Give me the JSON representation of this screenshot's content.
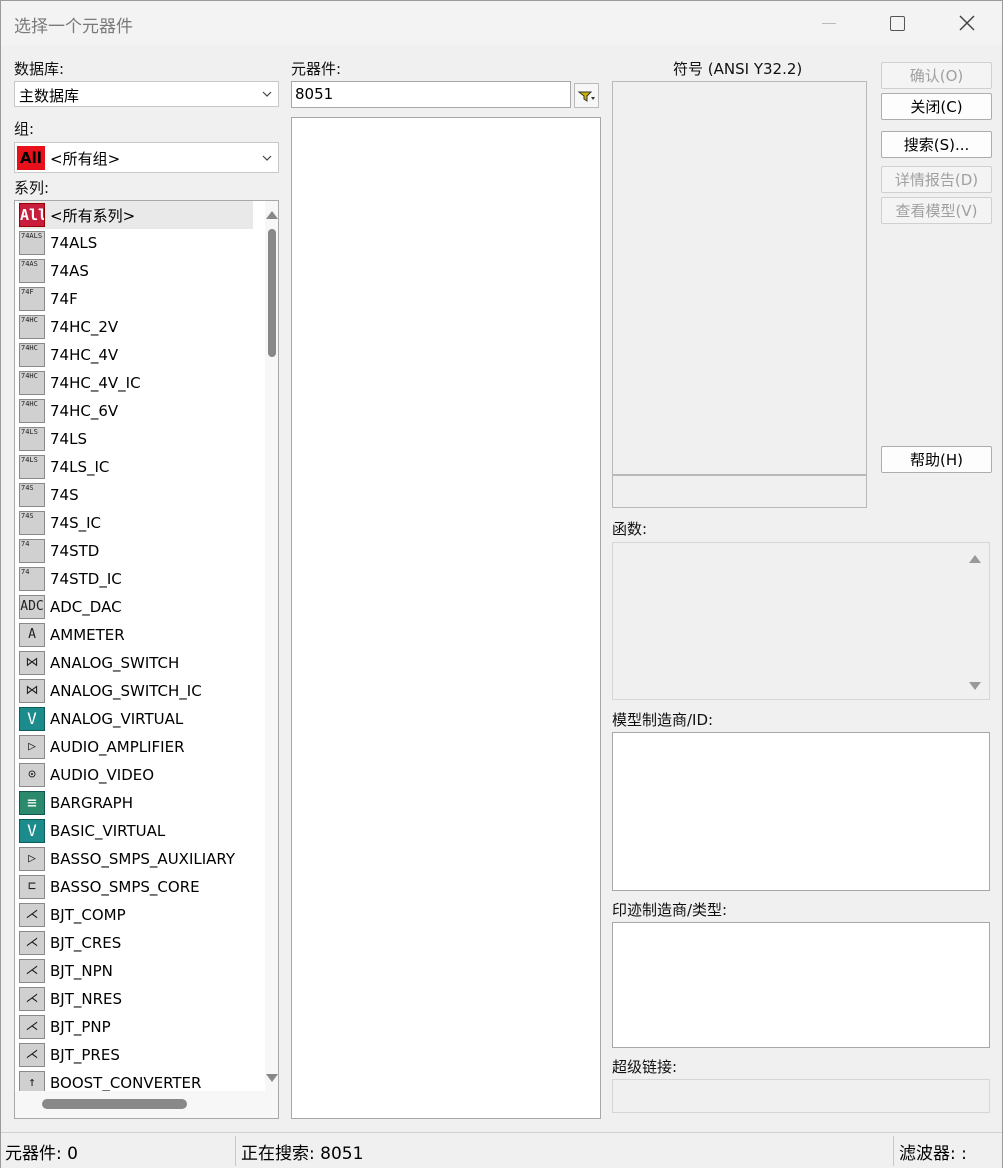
{
  "window": {
    "title": "选择一个元器件"
  },
  "database": {
    "label": "数据库:",
    "value": "主数据库"
  },
  "group": {
    "label": "组:",
    "value": "<所有组>",
    "icon_text": "All"
  },
  "series": {
    "label": "系列:",
    "items": [
      {
        "label": "<所有系列>",
        "icon": "All",
        "kind": "all"
      },
      {
        "label": "74ALS",
        "icon": "74ALS",
        "kind": "logic"
      },
      {
        "label": "74AS",
        "icon": "74AS",
        "kind": "logic"
      },
      {
        "label": "74F",
        "icon": "74F",
        "kind": "logic"
      },
      {
        "label": "74HC_2V",
        "icon": "74HC",
        "kind": "logic"
      },
      {
        "label": "74HC_4V",
        "icon": "74HC",
        "kind": "logic"
      },
      {
        "label": "74HC_4V_IC",
        "icon": "74HC",
        "kind": "logic"
      },
      {
        "label": "74HC_6V",
        "icon": "74HC",
        "kind": "logic"
      },
      {
        "label": "74LS",
        "icon": "74LS",
        "kind": "logic"
      },
      {
        "label": "74LS_IC",
        "icon": "74LS",
        "kind": "logic"
      },
      {
        "label": "74S",
        "icon": "74S",
        "kind": "logic"
      },
      {
        "label": "74S_IC",
        "icon": "74S",
        "kind": "logic"
      },
      {
        "label": "74STD",
        "icon": "74",
        "kind": "logic"
      },
      {
        "label": "74STD_IC",
        "icon": "74",
        "kind": "logic"
      },
      {
        "label": "ADC_DAC",
        "icon": "ADC DAC",
        "kind": "box"
      },
      {
        "label": "AMMETER",
        "icon": "A",
        "kind": "box"
      },
      {
        "label": "ANALOG_SWITCH",
        "icon": "⋈",
        "kind": "box"
      },
      {
        "label": "ANALOG_SWITCH_IC",
        "icon": "⋈",
        "kind": "box"
      },
      {
        "label": "ANALOG_VIRTUAL",
        "icon": "V",
        "kind": "teal"
      },
      {
        "label": "AUDIO_AMPLIFIER",
        "icon": "▷",
        "kind": "box"
      },
      {
        "label": "AUDIO_VIDEO",
        "icon": "⊙",
        "kind": "box"
      },
      {
        "label": "BARGRAPH",
        "icon": "≡",
        "kind": "bar"
      },
      {
        "label": "BASIC_VIRTUAL",
        "icon": "V",
        "kind": "teal"
      },
      {
        "label": "BASSO_SMPS_AUXILIARY",
        "icon": "▷",
        "kind": "box"
      },
      {
        "label": "BASSO_SMPS_CORE",
        "icon": "⊏",
        "kind": "box"
      },
      {
        "label": "BJT_COMP",
        "icon": "⋌",
        "kind": "box"
      },
      {
        "label": "BJT_CRES",
        "icon": "⋌",
        "kind": "box"
      },
      {
        "label": "BJT_NPN",
        "icon": "⋌",
        "kind": "box"
      },
      {
        "label": "BJT_NRES",
        "icon": "⋌",
        "kind": "box"
      },
      {
        "label": "BJT_PNP",
        "icon": "⋌",
        "kind": "box"
      },
      {
        "label": "BJT_PRES",
        "icon": "⋌",
        "kind": "box"
      },
      {
        "label": "BOOST_CONVERTER",
        "icon": "↑",
        "kind": "box"
      }
    ]
  },
  "component": {
    "label": "元器件:",
    "value": "8051"
  },
  "symbol": {
    "label": "符号 (ANSI Y32.2)"
  },
  "buttons": {
    "ok": "确认(O)",
    "close": "关闭(C)",
    "search": "搜索(S)...",
    "detail": "详情报告(D)",
    "model": "查看模型(V)",
    "help": "帮助(H)"
  },
  "function": {
    "label": "函数:"
  },
  "model_mfr": {
    "label": "模型制造商/ID:"
  },
  "footprint_mfr": {
    "label": "印迹制造商/类型:"
  },
  "hyperlink": {
    "label": "超级链接:"
  },
  "status": {
    "components": "元器件: 0",
    "searching": "正在搜索: 8051",
    "filter": "滤波器: :"
  },
  "colors": {
    "all_icon": "#c81d3c",
    "teal_icon": "#1b8b8b"
  }
}
